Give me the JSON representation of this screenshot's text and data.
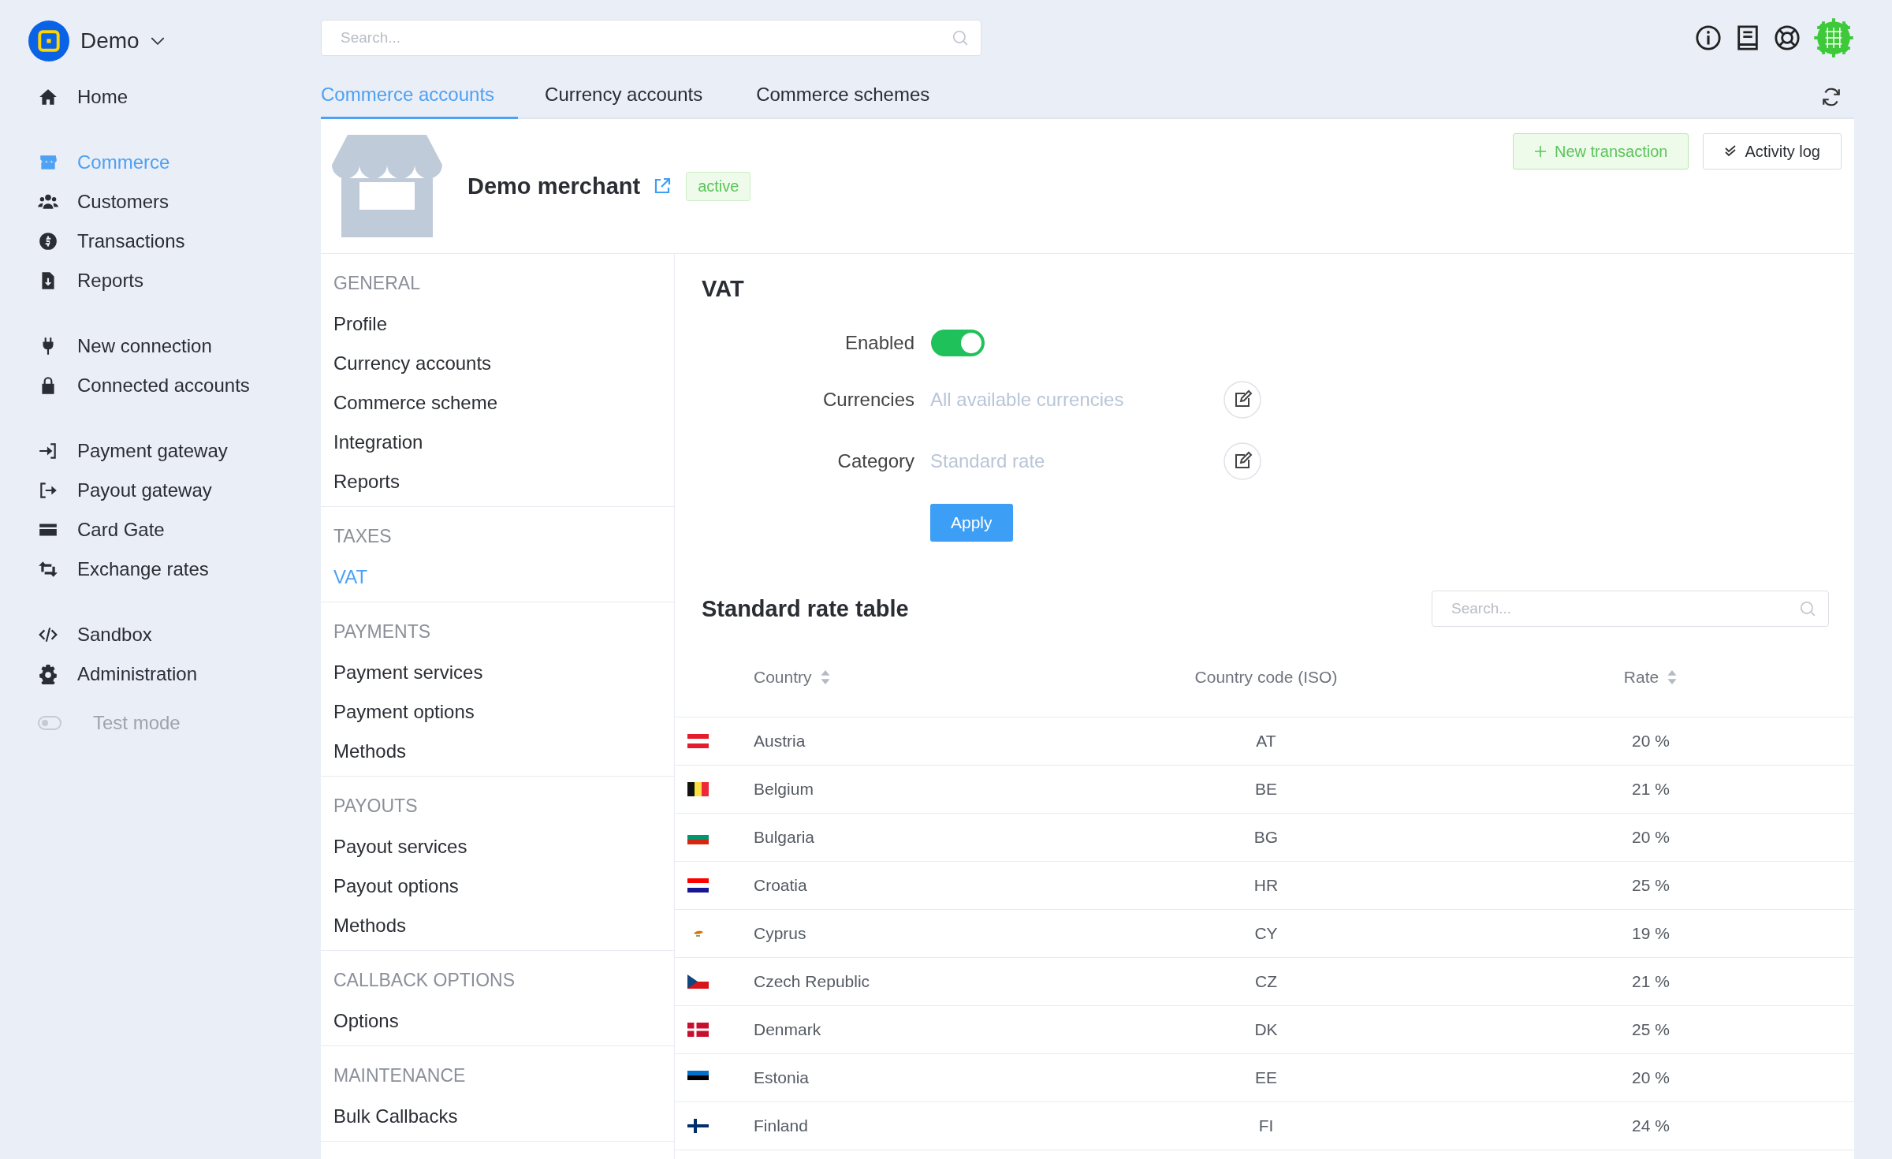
{
  "brand": {
    "name": "Demo"
  },
  "sidebar": {
    "groups": [
      {
        "items": [
          {
            "label": "Home",
            "selected": false
          }
        ]
      },
      {
        "items": [
          {
            "label": "Commerce",
            "selected": true
          },
          {
            "label": "Customers",
            "selected": false
          },
          {
            "label": "Transactions",
            "selected": false
          },
          {
            "label": "Reports",
            "selected": false
          }
        ]
      },
      {
        "items": [
          {
            "label": "New connection",
            "selected": false
          },
          {
            "label": "Connected accounts",
            "selected": false
          }
        ]
      },
      {
        "items": [
          {
            "label": "Payment gateway",
            "selected": false
          },
          {
            "label": "Payout gateway",
            "selected": false
          },
          {
            "label": "Card Gate",
            "selected": false
          },
          {
            "label": "Exchange rates",
            "selected": false
          }
        ]
      },
      {
        "items": [
          {
            "label": "Sandbox",
            "selected": false
          },
          {
            "label": "Administration",
            "selected": false
          }
        ]
      }
    ]
  },
  "test_mode": {
    "label": "Test mode",
    "on": false
  },
  "search": {
    "placeholder": "Search..."
  },
  "tabs": [
    {
      "label": "Commerce accounts",
      "selected": true
    },
    {
      "label": "Currency accounts",
      "selected": false
    },
    {
      "label": "Commerce schemes",
      "selected": false
    }
  ],
  "merchant": {
    "name": "Demo merchant",
    "status": "active"
  },
  "actions": [
    {
      "label": "New transaction",
      "kind": "add"
    },
    {
      "label": "Activity log",
      "kind": "log"
    }
  ],
  "subnav": {
    "sections": [
      {
        "title": "GENERAL",
        "items": [
          {
            "label": "Profile",
            "selected": false
          },
          {
            "label": "Currency accounts",
            "selected": false
          },
          {
            "label": "Commerce scheme",
            "selected": false
          },
          {
            "label": "Integration",
            "selected": false
          },
          {
            "label": "Reports",
            "selected": false
          }
        ]
      },
      {
        "title": "TAXES",
        "items": [
          {
            "label": "VAT",
            "selected": true
          }
        ]
      },
      {
        "title": "PAYMENTS",
        "items": [
          {
            "label": "Payment services",
            "selected": false
          },
          {
            "label": "Payment options",
            "selected": false
          },
          {
            "label": "Methods",
            "selected": false
          }
        ]
      },
      {
        "title": "PAYOUTS",
        "items": [
          {
            "label": "Payout services",
            "selected": false
          },
          {
            "label": "Payout options",
            "selected": false
          },
          {
            "label": "Methods",
            "selected": false
          }
        ]
      },
      {
        "title": "CALLBACK OPTIONS",
        "items": [
          {
            "label": "Options",
            "selected": false
          }
        ]
      },
      {
        "title": "MAINTENANCE",
        "items": [
          {
            "label": "Bulk Callbacks",
            "selected": false
          }
        ]
      }
    ]
  },
  "vat": {
    "title": "VAT",
    "enabled_label": "Enabled",
    "enabled": true,
    "fields": [
      {
        "label": "Currencies",
        "value": "All available currencies"
      },
      {
        "label": "Category",
        "value": "Standard rate"
      }
    ],
    "apply": "Apply"
  },
  "rate_table": {
    "title": "Standard rate table",
    "search_placeholder": "Search...",
    "columns": [
      {
        "label": "Country",
        "sortable": true
      },
      {
        "label": "Country code (ISO)",
        "sortable": false
      },
      {
        "label": "Rate",
        "sortable": true
      }
    ],
    "rows": [
      {
        "country": "Austria",
        "code": "AT",
        "rate": "20 %"
      },
      {
        "country": "Belgium",
        "code": "BE",
        "rate": "21 %"
      },
      {
        "country": "Bulgaria",
        "code": "BG",
        "rate": "20 %"
      },
      {
        "country": "Croatia",
        "code": "HR",
        "rate": "25 %"
      },
      {
        "country": "Cyprus",
        "code": "CY",
        "rate": "19 %"
      },
      {
        "country": "Czech Republic",
        "code": "CZ",
        "rate": "21 %"
      },
      {
        "country": "Denmark",
        "code": "DK",
        "rate": "25 %"
      },
      {
        "country": "Estonia",
        "code": "EE",
        "rate": "20 %"
      },
      {
        "country": "Finland",
        "code": "FI",
        "rate": "24 %"
      }
    ]
  }
}
